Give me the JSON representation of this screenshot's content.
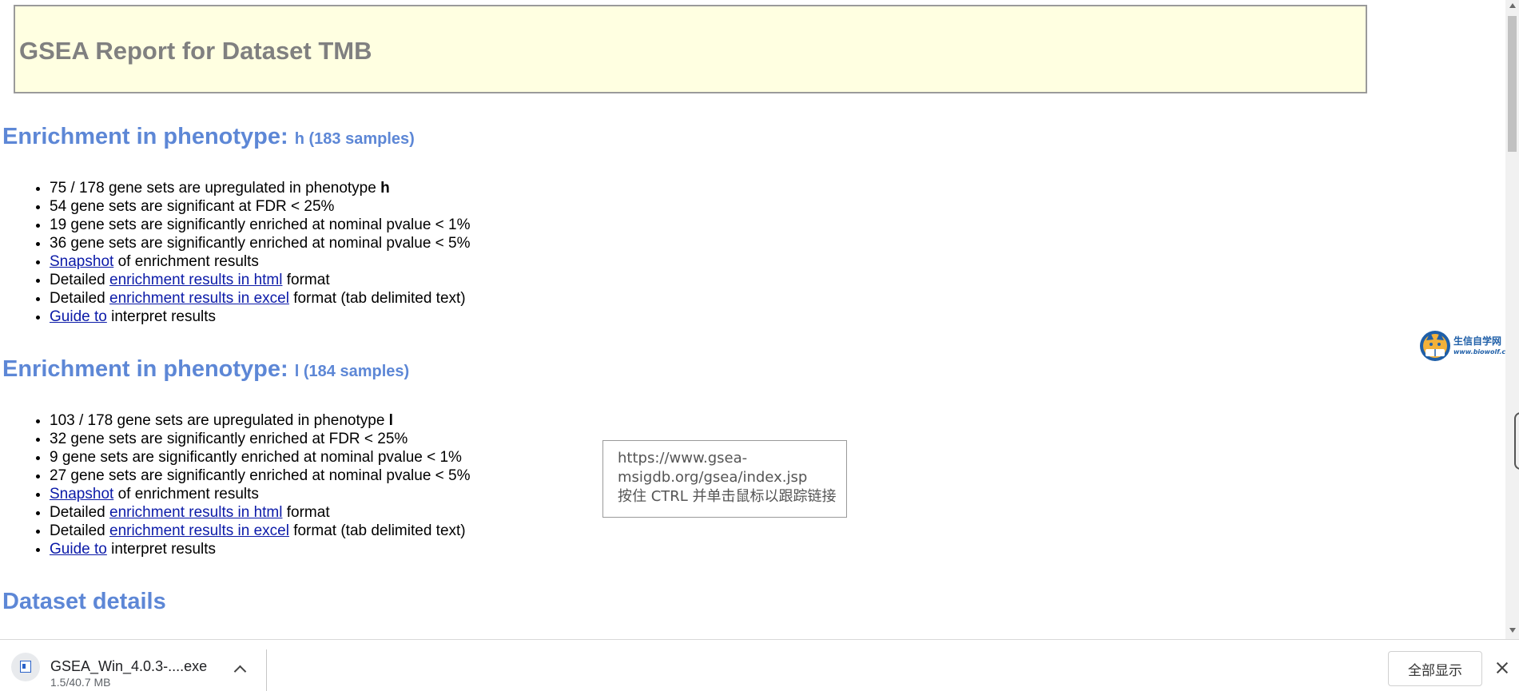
{
  "report_title": "GSEA Report for Dataset TMB",
  "sections": [
    {
      "heading": "Enrichment in phenotype: ",
      "phenotype_sub": "h (183 samples)",
      "bullets": {
        "upregulated": {
          "text": "75 / 178 gene sets are upregulated in phenotype ",
          "phenotype": "h"
        },
        "fdr": "54 gene sets are significant at FDR < 25%",
        "p1": "19 gene sets are significantly enriched at nominal pvalue < 1%",
        "p5": "36 gene sets are significantly enriched at nominal pvalue < 5%",
        "snapshot": {
          "link": "Snapshot",
          "rest": " of enrichment results"
        },
        "html": {
          "pre": "Detailed ",
          "link": "enrichment results in html",
          "rest": " format"
        },
        "excel": {
          "pre": "Detailed ",
          "link": "enrichment results in excel",
          "rest": " format (tab delimited text)"
        },
        "guide": {
          "link": "Guide to",
          "rest": " interpret results"
        }
      }
    },
    {
      "heading": "Enrichment in phenotype: ",
      "phenotype_sub": "l (184 samples)",
      "bullets": {
        "upregulated": {
          "text": "103 / 178 gene sets are upregulated in phenotype ",
          "phenotype": "l"
        },
        "fdr": "32 gene sets are significantly enriched at FDR < 25%",
        "p1": "9 gene sets are significantly enriched at nominal pvalue < 1%",
        "p5": "27 gene sets are significantly enriched at nominal pvalue < 5%",
        "snapshot": {
          "link": "Snapshot",
          "rest": " of enrichment results"
        },
        "html": {
          "pre": "Detailed ",
          "link": "enrichment results in html",
          "rest": " format"
        },
        "excel": {
          "pre": "Detailed ",
          "link": "enrichment results in excel",
          "rest": " format (tab delimited text)"
        },
        "guide": {
          "link": "Guide to",
          "rest": " interpret results"
        }
      }
    }
  ],
  "dataset_details_heading": "Dataset details",
  "tooltip": {
    "line1": "https://www.gsea-",
    "line2": "msigdb.org/gsea/index.jsp",
    "line3": "按住 CTRL 并单击鼠标以跟踪链接"
  },
  "logo": {
    "name": "生信自学网",
    "url": "www.biowolf.cn"
  },
  "download_bar": {
    "file_name": "GSEA_Win_4.0.3-....exe",
    "progress": "1.5/40.7 MB",
    "show_all": "全部显示"
  },
  "colors": {
    "heading": "#5d87d6",
    "title_bg": "#ffffe1",
    "title_text": "#808080",
    "link": "#0b1aa8"
  }
}
